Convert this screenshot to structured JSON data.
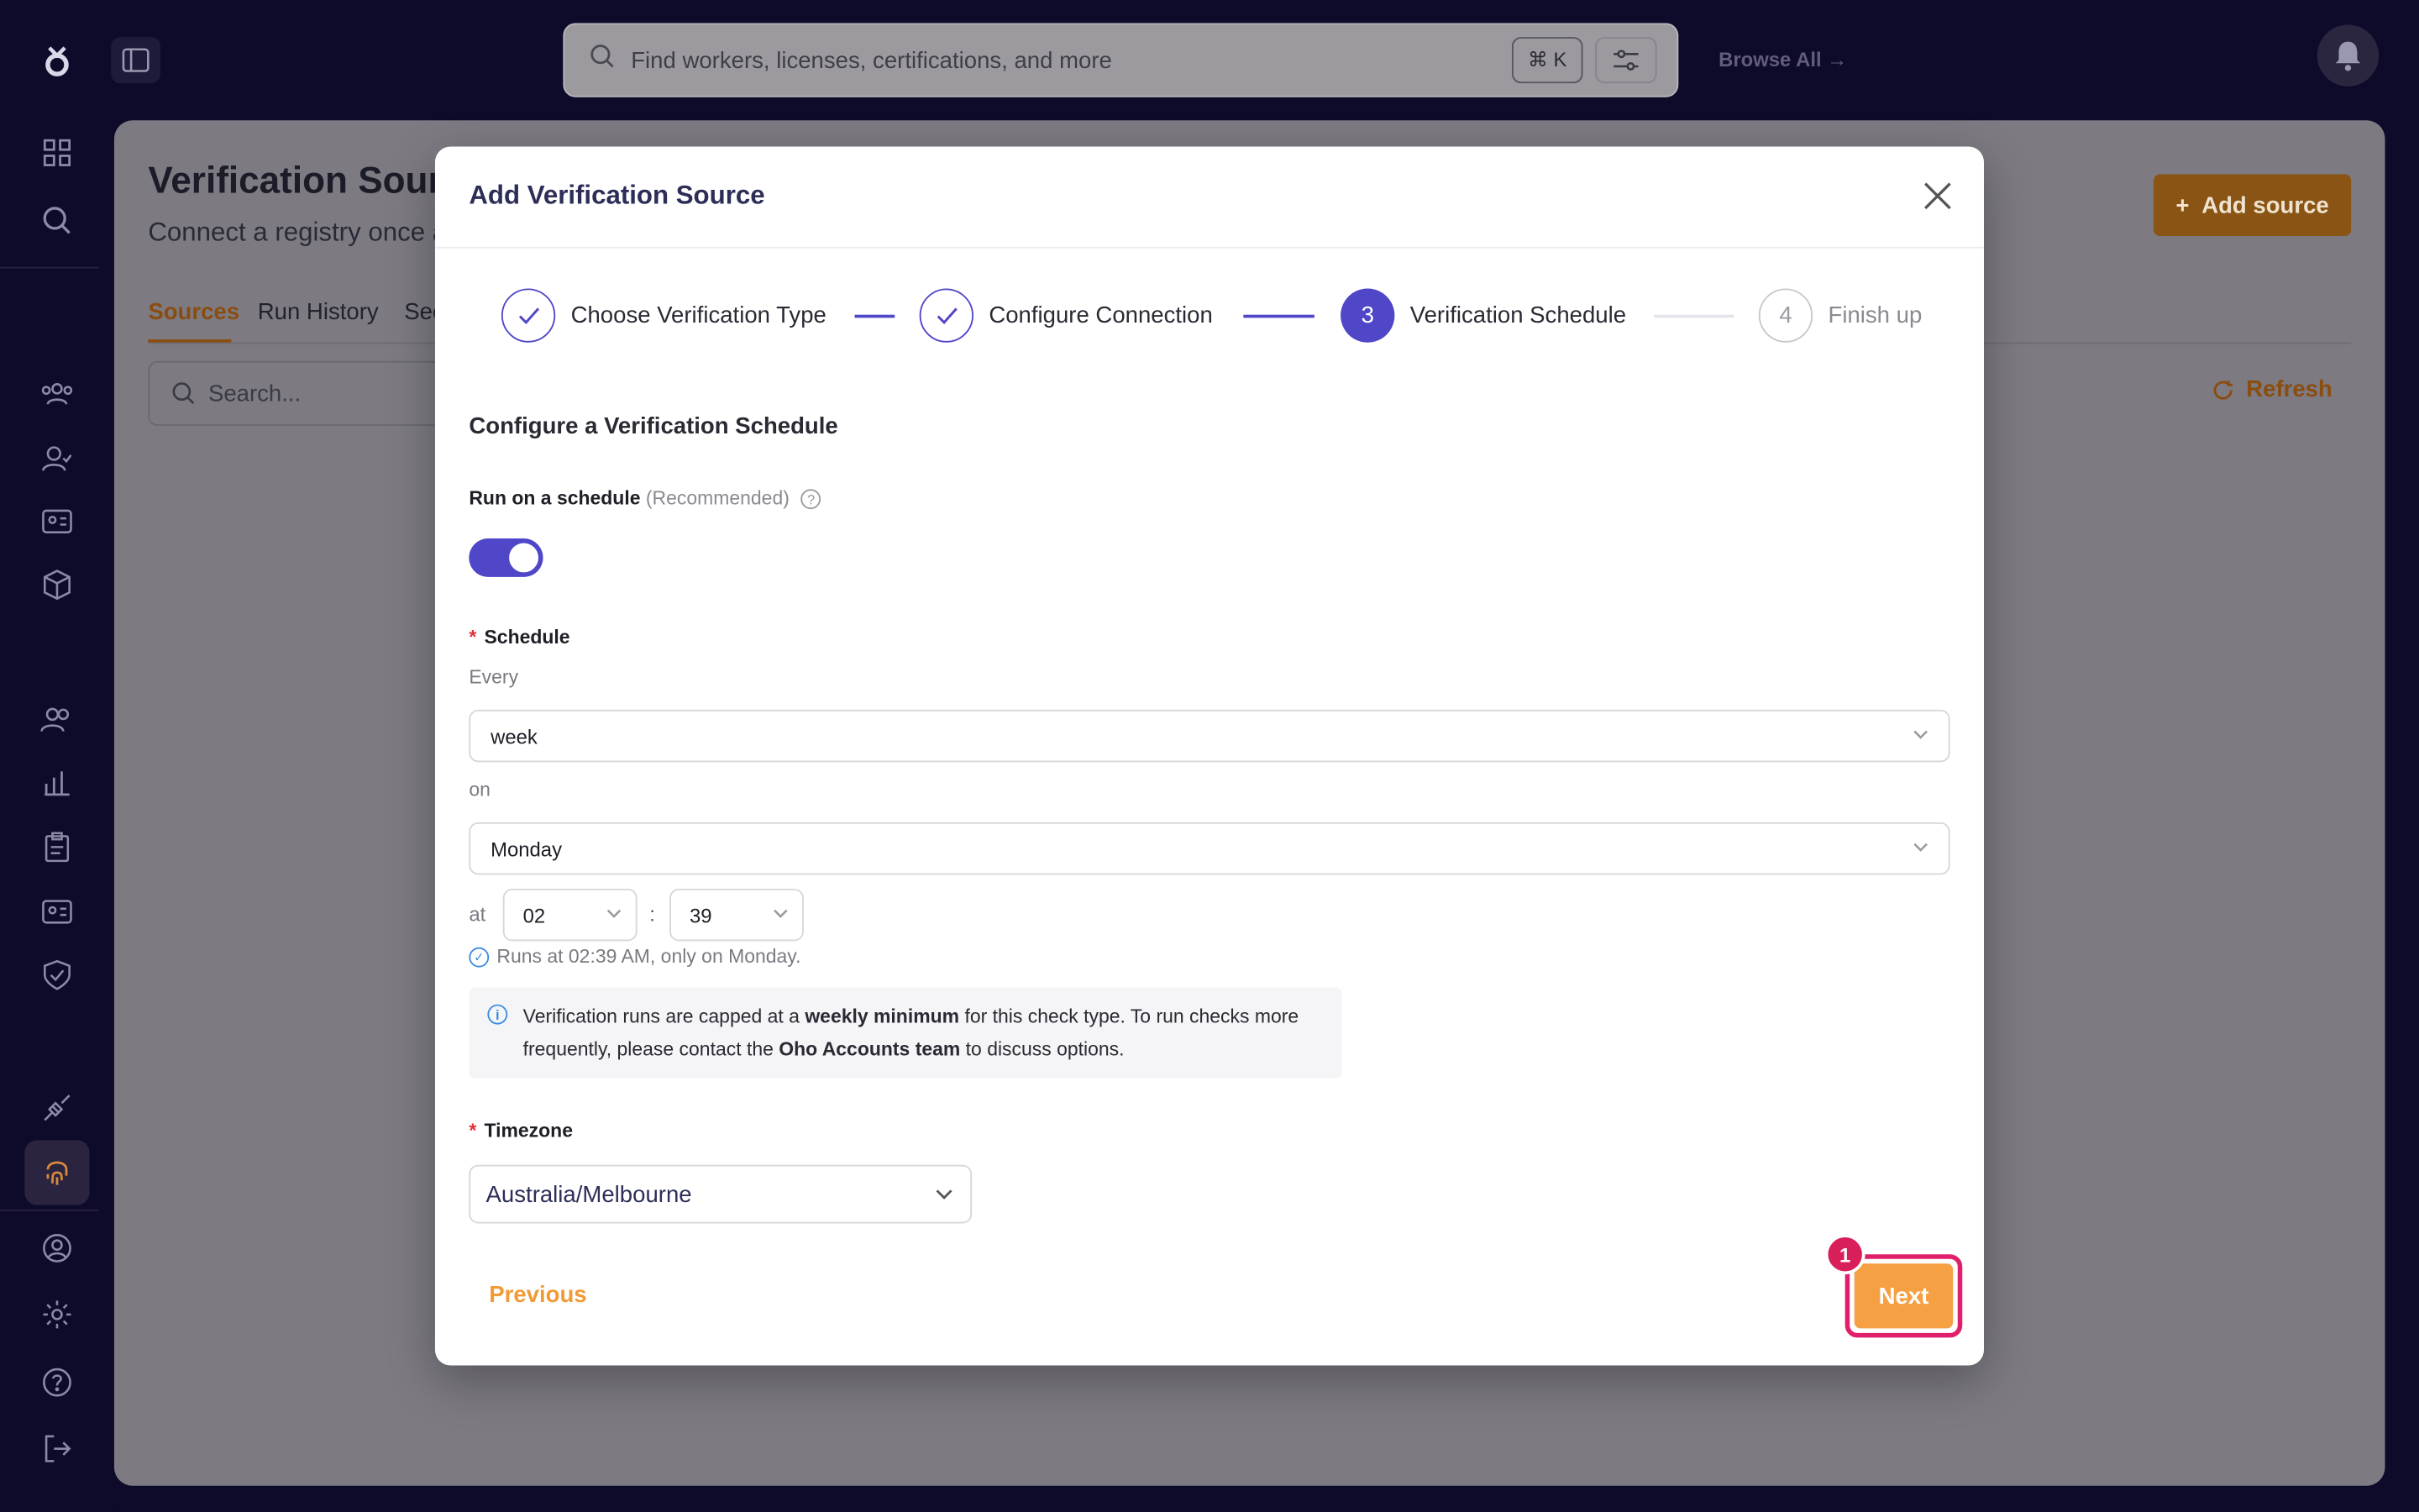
{
  "topbar": {
    "search_placeholder": "Find workers, licenses, certifications, and more",
    "shortcut": "⌘ K",
    "browse_all": "Browse All →"
  },
  "page": {
    "title": "Verification Sources",
    "subtitle": "Connect a registry once and keep verifications up to date",
    "tabs": [
      {
        "label": "Sources",
        "active": true
      },
      {
        "label": "Run History",
        "active": false
      },
      {
        "label": "Sec",
        "active": false
      }
    ],
    "search_placeholder": "Search...",
    "add_source": "Add source",
    "refresh": "Refresh"
  },
  "modal": {
    "title": "Add Verification Source",
    "steps": [
      {
        "number": "1",
        "label": "Choose Verification Type",
        "status": "done"
      },
      {
        "number": "2",
        "label": "Configure Connection",
        "status": "done"
      },
      {
        "number": "3",
        "label": "Verification Schedule",
        "status": "current"
      },
      {
        "number": "4",
        "label": "Finish up",
        "status": "pending"
      }
    ],
    "section_title": "Configure a Verification Schedule",
    "run_on_schedule": "Run on a schedule",
    "recommended": "(Recommended)",
    "schedule_toggle_on": true,
    "schedule_label": "Schedule",
    "every_label": "Every",
    "every_value": "week",
    "on_label": "on",
    "day_value": "Monday",
    "at_label": "at",
    "hour_value": "02",
    "colon": ":",
    "minute_value": "39",
    "runs_note": "Runs at 02:39 AM, only on Monday.",
    "info": {
      "part1": "Verification runs are capped at a ",
      "bold1": "weekly minimum",
      "part2": " for this check type. To run checks more frequently, please contact the ",
      "bold2": "Oho Accounts team",
      "part3": " to discuss options."
    },
    "timezone_label": "Timezone",
    "timezone_value": "Australia/Melbourne",
    "previous": "Previous",
    "next": "Next",
    "annotation_badge": "1"
  },
  "colors": {
    "accent": "#4f46c8",
    "orange": "#f5a043",
    "highlight": "#e0206a",
    "nav_bg": "#0e0a2a"
  }
}
